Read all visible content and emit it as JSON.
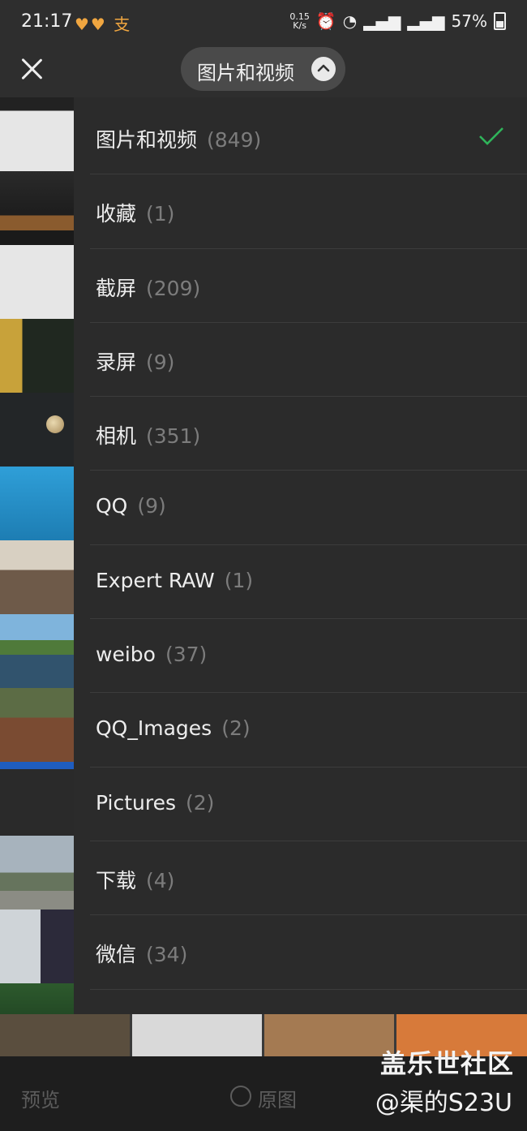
{
  "status_bar": {
    "time": "21:17",
    "left_icons": "♥♥ 支",
    "net_speed_value": "0.15",
    "net_speed_unit": "K/s",
    "battery": "57%"
  },
  "header": {
    "album_selector_label": "图片和视频"
  },
  "albums": [
    {
      "name": "图片和视频",
      "count": "(849)",
      "selected": true
    },
    {
      "name": "收藏",
      "count": "(1)"
    },
    {
      "name": "截屏",
      "count": "(209)"
    },
    {
      "name": "录屏",
      "count": "(9)"
    },
    {
      "name": "相机",
      "count": "(351)"
    },
    {
      "name": "QQ",
      "count": "(9)"
    },
    {
      "name": "Expert RAW",
      "count": "(1)"
    },
    {
      "name": "weibo",
      "count": "(37)"
    },
    {
      "name": "QQ_Images",
      "count": "(2)"
    },
    {
      "name": "Pictures",
      "count": "(2)"
    },
    {
      "name": "下载",
      "count": "(4)"
    },
    {
      "name": "微信",
      "count": "(34)"
    }
  ],
  "bottom_bar": {
    "preview_label": "预览",
    "original_label": "原图"
  },
  "watermark": {
    "title": "盖乐世社区",
    "user": "@渠的S23U"
  },
  "colors": {
    "accent_check": "#2fb45a",
    "background": "#2b2b2b"
  }
}
